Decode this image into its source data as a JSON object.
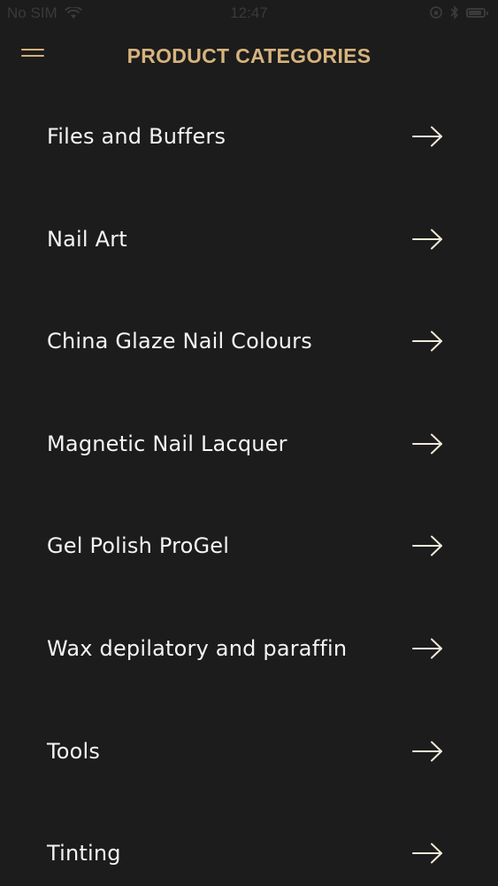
{
  "status_bar": {
    "carrier": "No SIM",
    "time": "12:47",
    "battery_level": 0.85,
    "icons": [
      "wifi-icon",
      "orientation-lock-icon",
      "bluetooth-icon",
      "battery-icon"
    ]
  },
  "header": {
    "title": "PRODUCT CATEGORIES",
    "menu_icon": "hamburger-menu-icon"
  },
  "categories": [
    {
      "label": "Files and Buffers",
      "icon": "arrow-right-icon"
    },
    {
      "label": "Nail Art",
      "icon": "arrow-right-icon"
    },
    {
      "label": "China Glaze Nail Colours",
      "icon": "arrow-right-icon"
    },
    {
      "label": "Magnetic Nail Lacquer",
      "icon": "arrow-right-icon"
    },
    {
      "label": "Gel Polish ProGel",
      "icon": "arrow-right-icon"
    },
    {
      "label": "Wax depilatory and paraffin",
      "icon": "arrow-right-icon"
    },
    {
      "label": "Tools",
      "icon": "arrow-right-icon"
    },
    {
      "label": "Tinting",
      "icon": "arrow-right-icon"
    }
  ],
  "colors": {
    "background": "#1c1c1c",
    "accent": "#d7b37d",
    "text": "#f4f4f4"
  }
}
